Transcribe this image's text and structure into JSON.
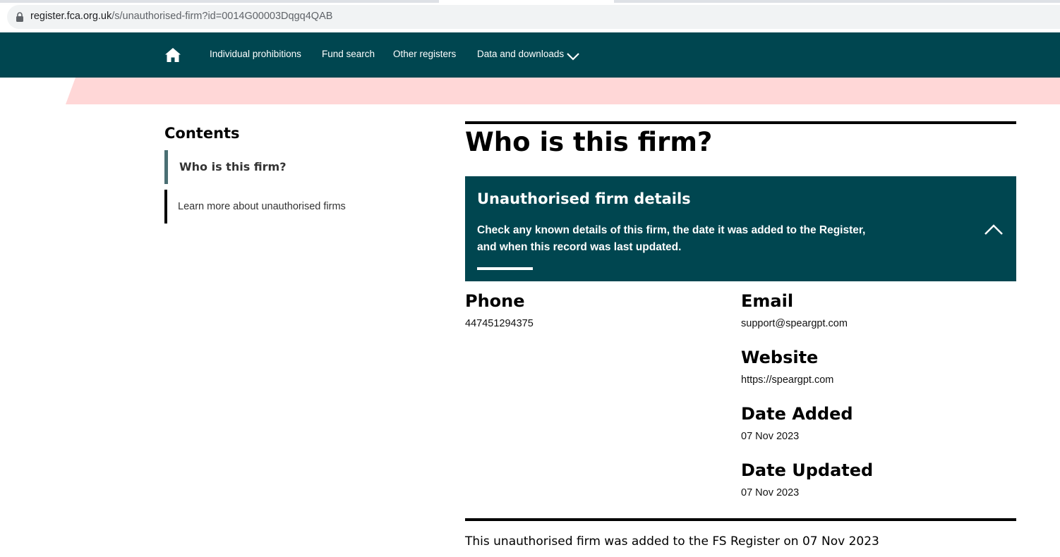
{
  "browser": {
    "url_host": "register.fca.org.uk",
    "url_path": "/s/unauthorised-firm?id=0014G00003Dqgq4QAB"
  },
  "nav": {
    "items": [
      "Individual prohibitions",
      "Fund search",
      "Other registers",
      "Data and downloads"
    ],
    "icons": {
      "home": "home-icon",
      "dropdown": "chevron-down-icon"
    }
  },
  "colors": {
    "header_teal": "#004650",
    "pink_band": "#ffd7d7",
    "toc_active_bar": "#4a6f73"
  },
  "contents": {
    "title": "Contents",
    "items": [
      "Who is this firm?",
      "Learn more about unauthorised firms"
    ]
  },
  "main": {
    "heading": "Who is this firm?",
    "panel": {
      "title": "Unauthorised firm details",
      "description": "Check any known details of this firm, the date it was added to the Register, and when this record was last updated.",
      "toggle_icon": "chevron-up-icon"
    },
    "fields": {
      "phone": {
        "label": "Phone",
        "value": "447451294375"
      },
      "email": {
        "label": "Email",
        "value": "support@speargpt.com"
      },
      "website": {
        "label": "Website",
        "value": "https://speargpt.com"
      },
      "date_added": {
        "label": "Date Added",
        "value": "07 Nov 2023"
      },
      "date_updated": {
        "label": "Date Updated",
        "value": "07 Nov 2023"
      }
    },
    "footer_note": "This unauthorised firm was added to the FS Register on 07 Nov 2023"
  }
}
